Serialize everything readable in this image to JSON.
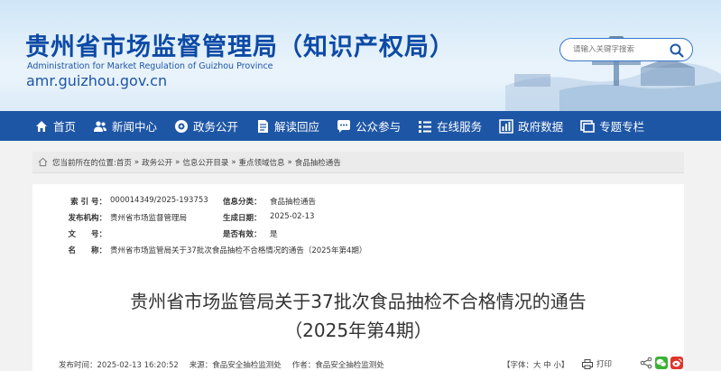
{
  "header": {
    "title": "贵州省市场监督管理局（知识产权局）",
    "subtitle": "Administration for Market Regulation of Guizhou Province",
    "domain": "amr.guizhou.gov.cn",
    "search_placeholder": "请输入关键字搜索"
  },
  "nav": {
    "items": [
      {
        "label": "首页",
        "icon": "home-icon"
      },
      {
        "label": "新闻中心",
        "icon": "people-icon"
      },
      {
        "label": "政务公开",
        "icon": "eye-icon"
      },
      {
        "label": "解读回应",
        "icon": "document-icon"
      },
      {
        "label": "公众参与",
        "icon": "chat-icon"
      },
      {
        "label": "在线服务",
        "icon": "list-icon"
      },
      {
        "label": "政府数据",
        "icon": "chart-icon"
      },
      {
        "label": "专题专栏",
        "icon": "window-icon"
      }
    ]
  },
  "breadcrumb": {
    "prefix": "您当前所在的位置:",
    "items": [
      "首页",
      "政务公开",
      "信息公开目录",
      "重点领域信息",
      "食品抽检通告"
    ],
    "separator": "»"
  },
  "meta": {
    "index_label": "索 引 号：",
    "index_value": "000014349/2025-193753",
    "category_label": "信息分类：",
    "category_value": "食品抽检通告",
    "org_label": "发布机构：",
    "org_value": "贵州省市场监督管理局",
    "date_label": "生成日期：",
    "date_value": "2025-02-13",
    "docno_label": "文　　号：",
    "docno_value": "",
    "valid_label": "是否有效：",
    "valid_value": "是",
    "name_label": "名　　称：",
    "name_value": "贵州省市场监管局关于37批次食品抽检不合格情况的通告（2025年第4期）"
  },
  "article": {
    "title_line1": "贵州省市场监管局关于37批次食品抽检不合格情况的通告",
    "title_line2": "（2025年第4期）"
  },
  "footer": {
    "publish_time": "发布时间：2025-02-13 16:20:52",
    "source": "来源：食品安全抽检监测处",
    "author": "作者：食品安全抽检监测处",
    "font_size": "【字体：大 中 小】",
    "print": "打印"
  },
  "colors": {
    "nav_bg": "#1e56a6",
    "title_blue": "#0d4aa6",
    "wechat": "#3cb034",
    "weibo": "#e0352b"
  }
}
